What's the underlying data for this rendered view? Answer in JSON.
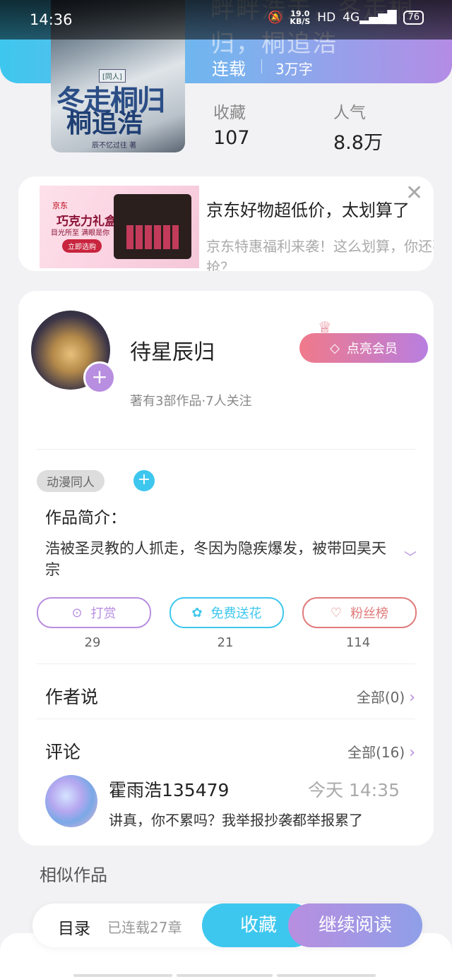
{
  "status_bar": {
    "time": "14:36",
    "net_speed_top": "19.0",
    "net_speed_bottom": "KB/S",
    "hd": "HD",
    "network": "4G",
    "battery": "76"
  },
  "book": {
    "title_faded": "畔畔浩走，冬走桐归，桐追浩",
    "cover": {
      "tag": "[同人]",
      "line1": "冬走桐归",
      "line2": "桐追浩",
      "author": "辰不忆过往 著"
    },
    "status": "连载",
    "word_count": "3万字",
    "stats": [
      {
        "label": "收藏",
        "value": "107"
      },
      {
        "label": "人气",
        "value": "8.8万"
      }
    ]
  },
  "ad": {
    "brand": "京东",
    "image_text1": "巧克力礼盒",
    "image_text2": "目光所至 满眼是你",
    "image_btn": "立即选购",
    "title": "京东好物超低价，太划算了",
    "desc": "京东特惠福利来袭！这么划算，你还不抢？",
    "close": "✕"
  },
  "author": {
    "name": "待星辰归",
    "meta": "著有3部作品·7人关注",
    "vip_label": "点亮会员"
  },
  "genre_tag": "动漫同人",
  "intro": {
    "title": "作品简介：",
    "text": "浩被圣灵教的人抓走，冬因为隐疾爆发，被带回昊天宗"
  },
  "actions": [
    {
      "label": "打赏",
      "count": "29",
      "color": "#b88ee0"
    },
    {
      "label": "免费送花",
      "count": "21",
      "color": "#3ec7ee"
    },
    {
      "label": "粉丝榜",
      "count": "114",
      "color": "#e07a7a"
    }
  ],
  "author_says": {
    "title": "作者说",
    "link": "全部(0)"
  },
  "comments": {
    "title": "评论",
    "link": "全部(16)",
    "item": {
      "user": "霍雨浩135479",
      "time": "今天 14:35",
      "text": "讲真，你不累吗？我举报抄袭都举报累了"
    }
  },
  "similar_title": "相似作品",
  "bottom_bar": {
    "toc": "目录",
    "chapters": "已连载27章",
    "fav": "收藏",
    "read": "继续阅读"
  }
}
